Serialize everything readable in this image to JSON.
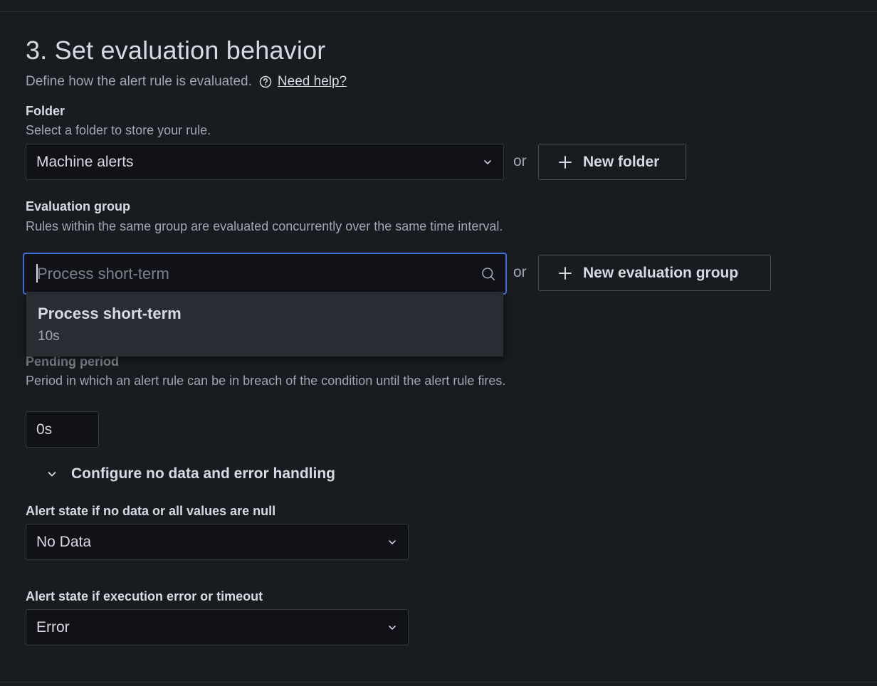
{
  "section": {
    "title": "3. Set evaluation behavior",
    "description": "Define how the alert rule is evaluated.",
    "help_link": "Need help?"
  },
  "folder": {
    "label": "Folder",
    "description": "Select a folder to store your rule.",
    "selected": "Machine alerts",
    "or": "or",
    "new_button": "New folder"
  },
  "evaluation_group": {
    "label": "Evaluation group",
    "description": "Rules within the same group are evaluated concurrently over the same time interval.",
    "search_placeholder": "Process short-term",
    "or": "or",
    "new_button": "New evaluation group",
    "options": [
      {
        "name": "Process short-term",
        "interval": "10s"
      }
    ]
  },
  "pending_period": {
    "label": "Pending period",
    "description": "Period in which an alert rule can be in breach of the condition until the alert rule fires.",
    "value": "0s"
  },
  "no_data_section": {
    "toggle_label": "Configure no data and error handling"
  },
  "no_data_state": {
    "label": "Alert state if no data or all values are null",
    "selected": "No Data"
  },
  "error_state": {
    "label": "Alert state if execution error or timeout",
    "selected": "Error"
  },
  "icons": {
    "help": "question-circle-icon",
    "chevron": "chevron-down-icon",
    "plus": "plus-icon",
    "search": "search-icon"
  },
  "colors": {
    "background": "#181b1f",
    "input_bg": "#111217",
    "focus_border": "#3d71d9",
    "dropdown_bg": "#2a2c33"
  }
}
